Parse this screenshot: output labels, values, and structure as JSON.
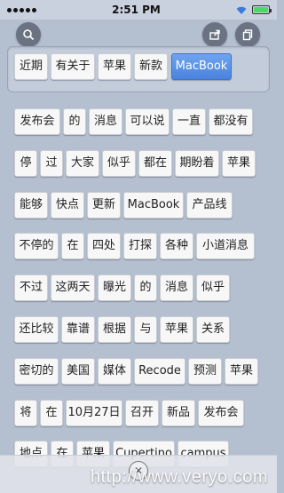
{
  "status": {
    "time": "2:51 PM"
  },
  "icons": {
    "search": "search-icon",
    "share": "share-icon",
    "copy": "copy-icon",
    "close": "close-icon"
  },
  "keywords": [
    "近期",
    "有关于",
    "苹果",
    "新款",
    "MacBook"
  ],
  "selected_keyword": "MacBook",
  "tags": [
    "发布会",
    "的",
    "消息",
    "可以说",
    "一直",
    "都没有",
    "停",
    "过",
    "大家",
    "似乎",
    "都在",
    "期盼着",
    "苹果",
    "能够",
    "快点",
    "更新",
    "MacBook",
    "产品线",
    "不停的",
    "在",
    "四处",
    "打探",
    "各种",
    "小道消息",
    "不过",
    "这两天",
    "曝光",
    "的",
    "消息",
    "似乎",
    "还比较",
    "靠谱",
    "根据",
    "与",
    "苹果",
    "关系",
    "密切的",
    "美国",
    "媒体",
    "Recode",
    "预测",
    "苹果",
    "将",
    "在",
    "10月27日",
    "召开",
    "新品",
    "发布会",
    "地点",
    "在",
    "苹果",
    "Cupertino",
    "campus"
  ],
  "watermark": "http://www.veryo.com",
  "colors": {
    "active_tag": "#4a82de",
    "background": "#b4bfd0"
  }
}
